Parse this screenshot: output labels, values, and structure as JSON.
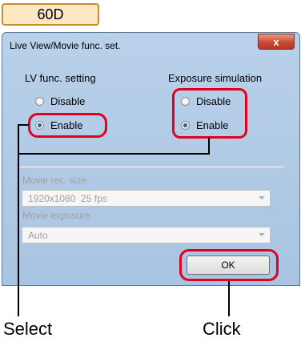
{
  "model_badge": "60D",
  "dialog": {
    "title": "Live View/Movie func. set.",
    "close_label": "x"
  },
  "lv_func": {
    "label": "LV func. setting",
    "options": [
      "Disable",
      "Enable"
    ],
    "selected": "Enable"
  },
  "exposure_sim": {
    "label": "Exposure simulation",
    "options": [
      "Disable",
      "Enable"
    ],
    "selected": "Enable"
  },
  "movie_rec_size": {
    "label": "Movie rec. size",
    "value": "1920x1080  25 fps"
  },
  "movie_exposure": {
    "label": "Movie exposure",
    "value": "Auto"
  },
  "ok_label": "OK",
  "callouts": {
    "select": "Select",
    "click": "Click"
  },
  "colors": {
    "highlight": "#e3001b",
    "badge_border": "#c88d2a",
    "badge_fill": "#fde8c3"
  }
}
